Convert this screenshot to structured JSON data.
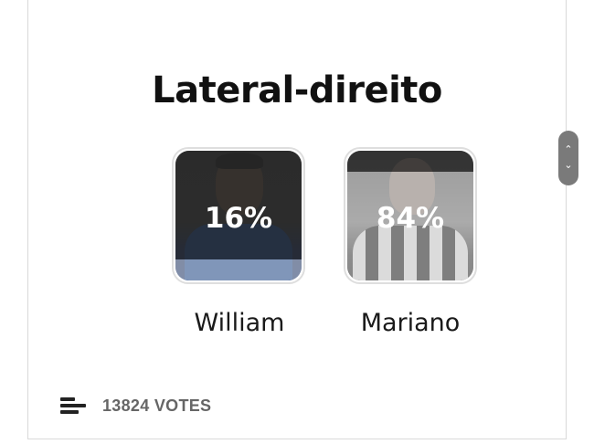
{
  "poll": {
    "title": "Lateral-direito",
    "options": [
      {
        "name": "William",
        "percent_label": "16%",
        "percent": 16
      },
      {
        "name": "Mariano",
        "percent_label": "84%",
        "percent": 84
      }
    ],
    "votes_label": "13824 VOTES"
  },
  "scroll_buttons": {
    "up": "⌃",
    "down": "⌄"
  },
  "icons": [
    "bar-chart-icon",
    "chevron-up-icon",
    "chevron-down-icon"
  ],
  "colors": {
    "title": "#111111",
    "votes_text": "#666666",
    "overlay": "#282828"
  }
}
